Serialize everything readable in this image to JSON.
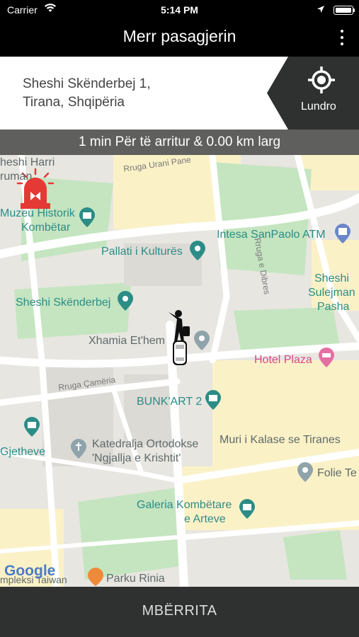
{
  "status_bar": {
    "carrier": "Carrier",
    "time": "5:14 PM"
  },
  "navbar": {
    "title": "Merr pasagjerin"
  },
  "address": {
    "line1": "Sheshi Skënderbej 1,",
    "line2": "Tirana,  Shqipëria"
  },
  "locate": {
    "label": "Lundro"
  },
  "eta": {
    "text": "1 min Për të arritur & 0.00 km larg"
  },
  "map": {
    "labels": {
      "sheshi_harri": "heshi Harri",
      "truman": "ruman",
      "muzeu": "Muzeu Historik",
      "kombetar": "Kombëtar",
      "pallati": "Pallati i Kulturës",
      "intesa": "Intesa SanPaolo ATM",
      "sheshi_skenderbej": "Sheshi Skënderbej",
      "sheshi_sulejman_1": "Sheshi",
      "sheshi_sulejman_2": "Sulejman",
      "sheshi_sulejman_3": "Pasha",
      "xhamia": "Xhamia Et'hem",
      "hotel": "Hotel Plaza",
      "bunkart": "BUNK'ART 2",
      "gjetheve": "Gjetheve",
      "katedralja_1": "Katedralja Ortodokse",
      "katedralja_2": "'Ngjallja e Krishtit'",
      "muri": "Muri i Kalase se Tiranes",
      "folie": "Folie Te",
      "galeria_1": "Galeria Kombëtare",
      "galeria_2": "e Arteve",
      "parku": "Parku Rinia",
      "komplex": "mpleksi Taiwan",
      "rruga_urani": "Rruga Urani Pane",
      "rruga_dibres": "Rruga e Dibres",
      "rruga_cameria": "Rruga Çamëria",
      "google": "Google"
    }
  },
  "action": {
    "label": "MBËRRITA"
  }
}
